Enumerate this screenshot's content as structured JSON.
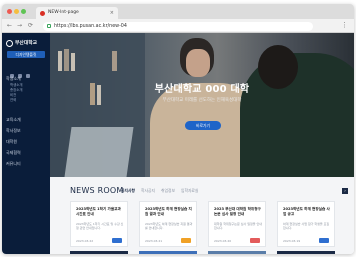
{
  "browser": {
    "tab_title": "NEW-lnt-page",
    "url": "https://lbs.pusan.ac.kr/new-04",
    "nav_back": "←",
    "nav_forward": "→",
    "nav_reload": "⟳",
    "menu": "⋮",
    "tab_close": "×",
    "traffic_colors": [
      "#ee5a52",
      "#f5be3f",
      "#5fc454"
    ]
  },
  "sidebar": {
    "logo_text": "부산대학교",
    "button_label": "디자인템플릿",
    "groups": [
      {
        "label": "학생소개",
        "subs": [
          "학생소개",
          "총장소개",
          "비전",
          "연혁"
        ]
      },
      {
        "label": "교육소개",
        "subs": []
      },
      {
        "label": "학사정보",
        "subs": []
      },
      {
        "label": "대학원",
        "subs": []
      },
      {
        "label": "국제협력",
        "subs": []
      },
      {
        "label": "커뮤니티",
        "subs": []
      }
    ]
  },
  "hero": {
    "title": "부산대학교 000 대학",
    "subtitle": "부산대학교 미래를 선도하는 인재육성대학",
    "button_label": "바로가기"
  },
  "news": {
    "title": "NEWS ROOM",
    "tabs": [
      "공지사항",
      "학사공지",
      "취업정보",
      "입학자료실"
    ],
    "next_label": "›",
    "cards": [
      {
        "title": "2023학년도 1학기 가을교과 시간표 안내",
        "desc": "2023학년도 1학기 시간표 및 수강 신청 관련 안내입니다.",
        "date": "2023.03.22",
        "badge_color": "#2f6fd0"
      },
      {
        "title": "2023학년도 하계 현장실습 지원 결과 안내",
        "desc": "2023학년도 하계 현장실습 지원 결과를 안내합니다.",
        "date": "2023.03.21",
        "badge_color": "#f0a126"
      },
      {
        "title": "2023 부산대 대학원 학위청구논문 심사 일정 안내",
        "desc": "대학원 학위청구논문 심사 일정을 안내합니다.",
        "date": "2023.03.20",
        "badge_color": "#e35b5b"
      },
      {
        "title": "2023학년도 하계 현장실습 사업 공고",
        "desc": "하계 현장실습 사업 참가 학생을 모집합니다.",
        "date": "2023.03.19",
        "badge_color": "#2f6fd0"
      }
    ]
  }
}
